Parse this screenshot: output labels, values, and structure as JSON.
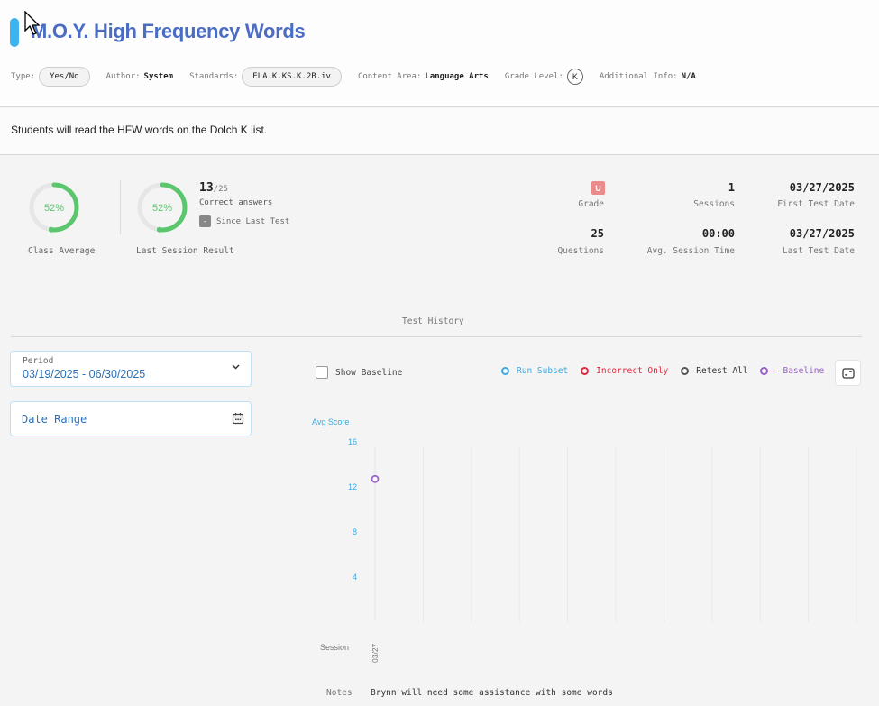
{
  "header": {
    "title": "M.O.Y. High Frequency Words",
    "type_label": "Type:",
    "type_value": "Yes/No",
    "author_label": "Author:",
    "author_value": "System",
    "standards_label": "Standards:",
    "standards_value": "ELA.K.KS.K.2B.iv",
    "content_area_label": "Content Area:",
    "content_area_value": "Language Arts",
    "grade_level_label": "Grade Level:",
    "grade_level_value": "K",
    "additional_info_label": "Additional Info:",
    "additional_info_value": "N/A"
  },
  "description": "Students will read the HFW words on the Dolch K list.",
  "stats": {
    "class_average": {
      "percent": 52,
      "text": "52%",
      "label": "Class Average"
    },
    "last_session": {
      "percent": 52,
      "text": "52%",
      "label": "Last Session Result"
    },
    "correct_count": "13",
    "correct_total": "/25",
    "correct_label": "Correct answers",
    "since_icon": "-",
    "since_label": "Since Last Test",
    "grade_value": "U",
    "grade_label": "Grade",
    "sessions_value": "1",
    "sessions_label": "Sessions",
    "first_test_value": "03/27/2025",
    "first_test_label": "First Test Date",
    "questions_value": "25",
    "questions_label": "Questions",
    "avg_time_value": "00:00",
    "avg_time_label": "Avg. Session Time",
    "last_test_value": "03/27/2025",
    "last_test_label": "Last Test Date"
  },
  "test_history": {
    "title": "Test History",
    "period_label": "Period",
    "period_value": "03/19/2025 - 06/30/2025",
    "date_range_placeholder": "Date Range",
    "show_baseline_label": "Show Baseline",
    "legend": {
      "run_subset": "Run Subset",
      "incorrect_only": "Incorrect Only",
      "retest_all": "Retest All",
      "baseline": "Baseline"
    },
    "notes_label": "Notes",
    "notes_value": "Brynn will need some assistance with some words"
  },
  "colors": {
    "accent": "#3cb4f0",
    "title": "#4a6cc2",
    "gauge": "#5cc66f",
    "run_subset": "#3ca9e0",
    "incorrect_only": "#e0283c",
    "retest_all": "#555555",
    "baseline": "#9b5ec8",
    "grade_badge": "#ea8a8a"
  },
  "chart_data": {
    "type": "scatter",
    "ylabel": "Avg Score",
    "xlabel": "Session",
    "ylim": [
      0,
      16
    ],
    "yticks": [
      "16",
      "12",
      "8",
      "4"
    ],
    "x": [
      "03/27"
    ],
    "series": [
      {
        "name": "Baseline",
        "values": [
          12.7
        ]
      }
    ]
  }
}
